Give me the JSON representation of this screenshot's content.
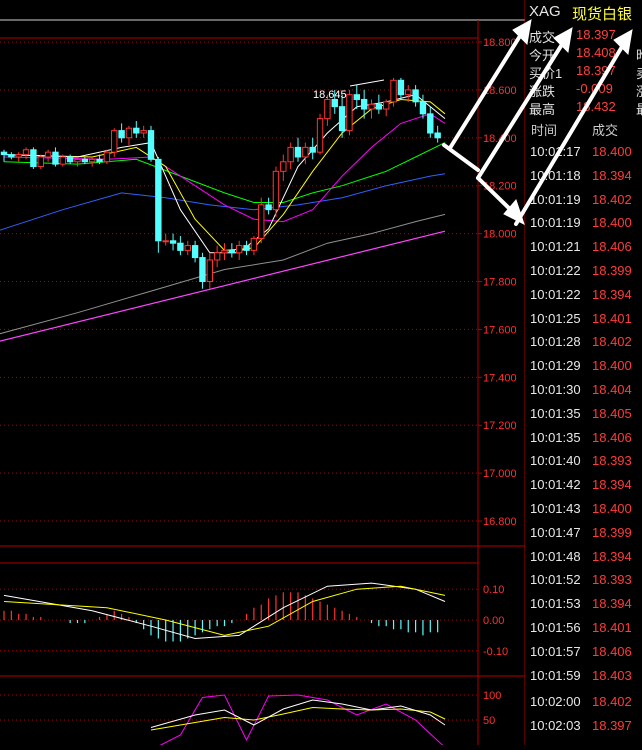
{
  "header": {
    "symbol": "XAG",
    "name": "现货白银"
  },
  "quote": [
    {
      "label": "成交",
      "value": "18.397",
      "extra": ""
    },
    {
      "label": "今开",
      "value": "18.408",
      "extra": "昨"
    },
    {
      "label": "买价1",
      "value": "18.397",
      "extra": "卖"
    },
    {
      "label": "涨跌",
      "value": "-0.009",
      "extra": "涨"
    },
    {
      "label": "最高",
      "value": "18.432",
      "extra": "最"
    }
  ],
  "ticks": {
    "col_time": "时间",
    "col_price": "成交",
    "rows": [
      {
        "time": "10:01:17",
        "price": "18.400"
      },
      {
        "time": "10:01:18",
        "price": "18.394"
      },
      {
        "time": "10:01:19",
        "price": "18.402"
      },
      {
        "time": "10:01:19",
        "price": "18.400"
      },
      {
        "time": "10:01:21",
        "price": "18.406"
      },
      {
        "time": "10:01:22",
        "price": "18.399"
      },
      {
        "time": "10:01:22",
        "price": "18.394"
      },
      {
        "time": "10:01:25",
        "price": "18.401"
      },
      {
        "time": "10:01:28",
        "price": "18.402"
      },
      {
        "time": "10:01:29",
        "price": "18.400"
      },
      {
        "time": "10:01:30",
        "price": "18.404"
      },
      {
        "time": "10:01:35",
        "price": "18.405"
      },
      {
        "time": "10:01:35",
        "price": "18.406"
      },
      {
        "time": "10:01:40",
        "price": "18.393"
      },
      {
        "time": "10:01:42",
        "price": "18.394"
      },
      {
        "time": "10:01:43",
        "price": "18.400"
      },
      {
        "time": "10:01:47",
        "price": "18.399"
      },
      {
        "time": "10:01:48",
        "price": "18.394"
      },
      {
        "time": "10:01:52",
        "price": "18.393"
      },
      {
        "time": "10:01:53",
        "price": "18.394"
      },
      {
        "time": "10:01:56",
        "price": "18.401"
      },
      {
        "time": "10:01:57",
        "price": "18.406"
      },
      {
        "time": "10:01:59",
        "price": "18.403"
      },
      {
        "time": "10:02:00",
        "price": "18.402"
      },
      {
        "time": "10:02:03",
        "price": "18.397"
      }
    ]
  },
  "main_axis": {
    "labels": [
      "18.800",
      "18.600",
      "18.400",
      "18.200",
      "18.000",
      "17.800",
      "17.600",
      "17.400",
      "17.200",
      "17.000",
      "16.800"
    ],
    "ylim": [
      16.7,
      18.85
    ]
  },
  "high_marker": "18.645",
  "macd_axis": {
    "labels": [
      "0.10",
      "0.00",
      "-0.10"
    ]
  },
  "kdj_axis": {
    "labels": [
      "100",
      "50"
    ]
  },
  "colors": {
    "up": "#ff3232",
    "down": "#54ffff",
    "axis": "#b00000",
    "ma5": "#ffffff",
    "ma10": "#ffff00",
    "ma20": "#ff00ff",
    "ma30": "#00ff00",
    "ma60": "#3060ff",
    "ma120": "#909090",
    "trend": "#ff44ff"
  },
  "chart_data": {
    "type": "candlestick",
    "candles": [
      [
        18.34,
        18.35,
        18.3,
        18.33
      ],
      [
        18.33,
        18.34,
        18.31,
        18.32
      ],
      [
        18.32,
        18.34,
        18.3,
        18.33
      ],
      [
        18.33,
        18.36,
        18.31,
        18.35
      ],
      [
        18.35,
        18.36,
        18.27,
        18.28
      ],
      [
        18.28,
        18.33,
        18.27,
        18.32
      ],
      [
        18.32,
        18.35,
        18.3,
        18.34
      ],
      [
        18.34,
        18.36,
        18.28,
        18.29
      ],
      [
        18.29,
        18.33,
        18.28,
        18.32
      ],
      [
        18.32,
        18.33,
        18.29,
        18.3
      ],
      [
        18.3,
        18.32,
        18.28,
        18.31
      ],
      [
        18.31,
        18.32,
        18.29,
        18.3
      ],
      [
        18.3,
        18.32,
        18.28,
        18.31
      ],
      [
        18.31,
        18.33,
        18.29,
        18.3
      ],
      [
        18.3,
        18.35,
        18.29,
        18.34
      ],
      [
        18.34,
        18.44,
        18.32,
        18.43
      ],
      [
        18.43,
        18.46,
        18.38,
        18.4
      ],
      [
        18.4,
        18.45,
        18.37,
        18.44
      ],
      [
        18.44,
        18.47,
        18.4,
        18.42
      ],
      [
        18.42,
        18.45,
        18.4,
        18.43
      ],
      [
        18.43,
        18.45,
        18.3,
        18.31
      ],
      [
        18.31,
        18.32,
        17.92,
        17.97
      ],
      [
        17.97,
        18.0,
        17.95,
        17.97
      ],
      [
        17.97,
        18.0,
        17.93,
        17.96
      ],
      [
        17.96,
        17.99,
        17.91,
        17.93
      ],
      [
        17.93,
        17.97,
        17.91,
        17.95
      ],
      [
        17.95,
        17.97,
        17.88,
        17.9
      ],
      [
        17.9,
        17.92,
        17.77,
        17.8
      ],
      [
        17.8,
        17.92,
        17.77,
        17.89
      ],
      [
        17.89,
        17.95,
        17.86,
        17.92
      ],
      [
        17.92,
        17.96,
        17.89,
        17.93
      ],
      [
        17.93,
        17.96,
        17.9,
        17.92
      ],
      [
        17.92,
        17.97,
        17.89,
        17.95
      ],
      [
        17.95,
        17.97,
        17.91,
        17.93
      ],
      [
        17.93,
        17.99,
        17.91,
        17.98
      ],
      [
        17.98,
        18.15,
        17.96,
        18.12
      ],
      [
        18.12,
        18.15,
        18.08,
        18.1
      ],
      [
        18.1,
        18.28,
        18.07,
        18.26
      ],
      [
        18.26,
        18.33,
        18.22,
        18.3
      ],
      [
        18.3,
        18.38,
        18.27,
        18.36
      ],
      [
        18.36,
        18.4,
        18.3,
        18.32
      ],
      [
        18.32,
        18.38,
        18.29,
        18.36
      ],
      [
        18.36,
        18.4,
        18.31,
        18.34
      ],
      [
        18.34,
        18.5,
        18.33,
        18.48
      ],
      [
        18.48,
        18.58,
        18.45,
        18.56
      ],
      [
        18.56,
        18.6,
        18.5,
        18.53
      ],
      [
        18.53,
        18.58,
        18.4,
        18.43
      ],
      [
        18.43,
        18.6,
        18.41,
        18.58
      ],
      [
        18.58,
        18.62,
        18.52,
        18.56
      ],
      [
        18.56,
        18.6,
        18.48,
        18.52
      ],
      [
        18.52,
        18.56,
        18.48,
        18.54
      ],
      [
        18.54,
        18.58,
        18.5,
        18.52
      ],
      [
        18.52,
        18.56,
        18.49,
        18.55
      ],
      [
        18.55,
        18.65,
        18.53,
        18.64
      ],
      [
        18.64,
        18.65,
        18.56,
        18.58
      ],
      [
        18.58,
        18.62,
        18.55,
        18.6
      ],
      [
        18.6,
        18.62,
        18.53,
        18.55
      ],
      [
        18.55,
        18.58,
        18.48,
        18.5
      ],
      [
        18.5,
        18.53,
        18.4,
        18.42
      ],
      [
        18.42,
        18.45,
        18.38,
        18.4
      ]
    ],
    "ma": {
      "ma5": [
        [
          0,
          18.33
        ],
        [
          10,
          18.32
        ],
        [
          16,
          18.36
        ],
        [
          20,
          18.38
        ],
        [
          24,
          18.1
        ],
        [
          28,
          17.92
        ],
        [
          32,
          17.92
        ],
        [
          36,
          18.02
        ],
        [
          40,
          18.28
        ],
        [
          44,
          18.42
        ],
        [
          48,
          18.53
        ],
        [
          52,
          18.55
        ],
        [
          56,
          18.58
        ],
        [
          60,
          18.48
        ]
      ],
      "ma10": [
        [
          0,
          18.33
        ],
        [
          12,
          18.32
        ],
        [
          18,
          18.36
        ],
        [
          22,
          18.28
        ],
        [
          26,
          18.06
        ],
        [
          30,
          17.93
        ],
        [
          34,
          17.94
        ],
        [
          38,
          18.08
        ],
        [
          42,
          18.26
        ],
        [
          46,
          18.42
        ],
        [
          50,
          18.52
        ],
        [
          54,
          18.56
        ],
        [
          58,
          18.55
        ],
        [
          60,
          18.5
        ]
      ],
      "ma20": [
        [
          0,
          18.32
        ],
        [
          14,
          18.31
        ],
        [
          20,
          18.32
        ],
        [
          26,
          18.2
        ],
        [
          30,
          18.12
        ],
        [
          34,
          18.06
        ],
        [
          38,
          18.05
        ],
        [
          42,
          18.1
        ],
        [
          46,
          18.24
        ],
        [
          50,
          18.36
        ],
        [
          54,
          18.46
        ],
        [
          58,
          18.5
        ],
        [
          60,
          18.46
        ]
      ],
      "ma30": [
        [
          0,
          18.3
        ],
        [
          10,
          18.29
        ],
        [
          18,
          18.31
        ],
        [
          24,
          18.24
        ],
        [
          30,
          18.17
        ],
        [
          34,
          18.13
        ],
        [
          38,
          18.13
        ],
        [
          42,
          18.17
        ],
        [
          46,
          18.2
        ],
        [
          52,
          18.26
        ],
        [
          56,
          18.32
        ],
        [
          60,
          18.38
        ]
      ],
      "ma60": [
        [
          -2,
          18.0
        ],
        [
          8,
          18.1
        ],
        [
          16,
          18.17
        ],
        [
          22,
          18.15
        ],
        [
          28,
          18.12
        ],
        [
          34,
          18.1
        ],
        [
          40,
          18.12
        ],
        [
          46,
          18.15
        ],
        [
          52,
          18.2
        ],
        [
          58,
          18.24
        ],
        [
          60,
          18.25
        ]
      ],
      "ma120": [
        [
          -2,
          17.57
        ],
        [
          10,
          17.67
        ],
        [
          20,
          17.76
        ],
        [
          30,
          17.85
        ],
        [
          38,
          17.89
        ],
        [
          44,
          17.96
        ],
        [
          50,
          18.0
        ],
        [
          56,
          18.05
        ],
        [
          60,
          18.08
        ]
      ],
      "trend": [
        [
          -2,
          17.54
        ],
        [
          60,
          18.01
        ]
      ]
    },
    "macd_hist": [
      0.03,
      0.03,
      0.02,
      0.02,
      0.01,
      0.01,
      0.0,
      0.0,
      0.0,
      -0.01,
      -0.01,
      -0.01,
      0.0,
      0.01,
      0.02,
      0.03,
      0.02,
      0.01,
      -0.01,
      -0.03,
      -0.05,
      -0.06,
      -0.07,
      -0.07,
      -0.07,
      -0.06,
      -0.05,
      -0.04,
      -0.03,
      -0.02,
      -0.02,
      -0.01,
      0.0,
      0.02,
      0.04,
      0.05,
      0.07,
      0.08,
      0.09,
      0.09,
      0.09,
      0.08,
      0.07,
      0.06,
      0.05,
      0.04,
      0.03,
      0.02,
      0.01,
      0.0,
      -0.01,
      -0.02,
      -0.02,
      -0.03,
      -0.03,
      -0.04,
      -0.04,
      -0.05,
      -0.04,
      -0.04
    ],
    "macd_dif": [
      [
        0,
        0.08
      ],
      [
        12,
        0.03
      ],
      [
        20,
        -0.02
      ],
      [
        26,
        -0.06
      ],
      [
        32,
        -0.05
      ],
      [
        38,
        0.04
      ],
      [
        44,
        0.11
      ],
      [
        50,
        0.12
      ],
      [
        56,
        0.1
      ],
      [
        60,
        0.06
      ]
    ],
    "macd_dea": [
      [
        0,
        0.06
      ],
      [
        14,
        0.04
      ],
      [
        22,
        0.0
      ],
      [
        30,
        -0.05
      ],
      [
        36,
        -0.02
      ],
      [
        42,
        0.06
      ],
      [
        48,
        0.1
      ],
      [
        54,
        0.11
      ],
      [
        60,
        0.08
      ]
    ],
    "kdj_k": [
      [
        20,
        35
      ],
      [
        26,
        60
      ],
      [
        30,
        70
      ],
      [
        34,
        40
      ],
      [
        38,
        72
      ],
      [
        42,
        90
      ],
      [
        46,
        82
      ],
      [
        50,
        70
      ],
      [
        54,
        78
      ],
      [
        58,
        60
      ],
      [
        60,
        40
      ]
    ],
    "kdj_d": [
      [
        20,
        30
      ],
      [
        26,
        45
      ],
      [
        30,
        55
      ],
      [
        34,
        50
      ],
      [
        38,
        62
      ],
      [
        42,
        75
      ],
      [
        46,
        72
      ],
      [
        50,
        70
      ],
      [
        54,
        72
      ],
      [
        58,
        66
      ],
      [
        60,
        52
      ]
    ],
    "kdj_j": [
      [
        20,
        -10
      ],
      [
        24,
        20
      ],
      [
        27,
        95
      ],
      [
        30,
        100
      ],
      [
        33,
        10
      ],
      [
        36,
        98
      ],
      [
        40,
        100
      ],
      [
        44,
        90
      ],
      [
        48,
        60
      ],
      [
        52,
        82
      ],
      [
        56,
        50
      ],
      [
        60,
        -5
      ]
    ]
  }
}
